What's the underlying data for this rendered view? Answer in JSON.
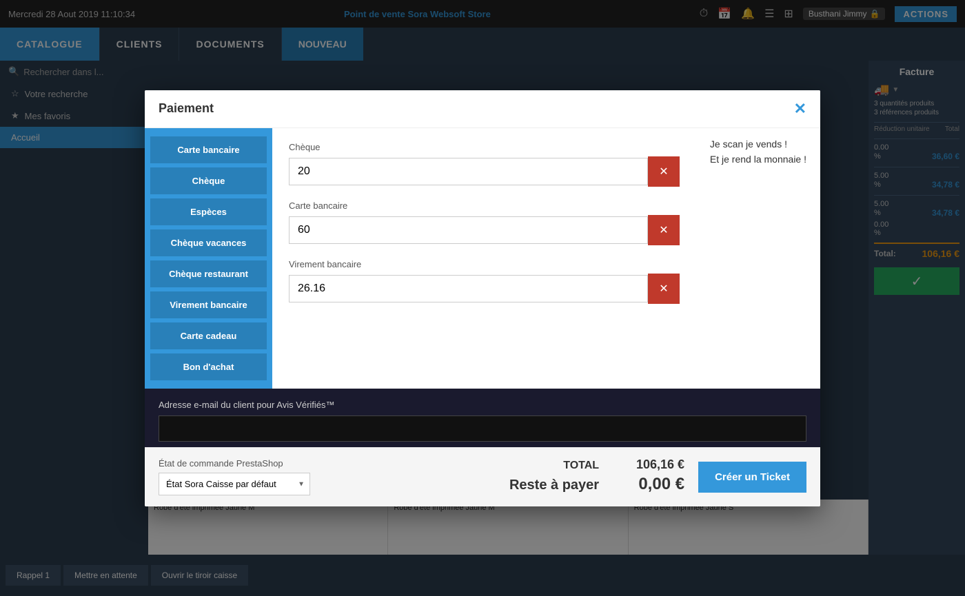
{
  "topbar": {
    "datetime": "Mercredi 28 Aout 2019 11:10:34",
    "pos_label": "Point de vente",
    "store_name": "Sora Websoft Store",
    "user": "Busthani Jimmy",
    "actions_label": "ACTIONS"
  },
  "nav": {
    "items": [
      {
        "label": "CATALOGUE",
        "active": true
      },
      {
        "label": "CLIENTS",
        "active": false
      },
      {
        "label": "DOCUMENTS",
        "active": false
      }
    ],
    "new_label": "NOUVEAU"
  },
  "sidebar": {
    "search_placeholder": "Rechercher dans l...",
    "items": [
      {
        "label": "Votre recherche",
        "icon": "★"
      },
      {
        "label": "Mes favoris",
        "icon": "★"
      }
    ],
    "home_label": "Accueil"
  },
  "right_panel": {
    "title": "Facture",
    "qty_label": "3 quantités produits",
    "ref_label": "3 références produits",
    "reduction_label": "Réduction unitaire",
    "total_label": "Total",
    "rows": [
      {
        "reduction": "0.00",
        "pct": "%",
        "total": "36,60 €"
      },
      {
        "reduction": "5.00",
        "pct": "%",
        "total": "34,78 €"
      },
      {
        "reduction": "5.00",
        "pct": "%",
        "total": "34,78 €"
      }
    ],
    "grand_total_label": "Total:",
    "grand_total_value": "106,16 €"
  },
  "modal": {
    "title": "Paiement",
    "close_label": "✕",
    "methods": [
      {
        "label": "Carte bancaire"
      },
      {
        "label": "Chèque"
      },
      {
        "label": "Espèces"
      },
      {
        "label": "Chèque vacances"
      },
      {
        "label": "Chèque restaurant"
      },
      {
        "label": "Virement bancaire"
      },
      {
        "label": "Carte cadeau"
      },
      {
        "label": "Bon d'achat"
      }
    ],
    "entries": [
      {
        "label": "Chèque",
        "value": "20",
        "remove": "✕"
      },
      {
        "label": "Carte bancaire",
        "value": "60",
        "remove": "✕"
      },
      {
        "label": "Virement bancaire",
        "value": "26.16",
        "remove": "✕"
      }
    ],
    "message_line1": "Je scan je vends !",
    "message_line2": "Et je rend la monnaie !",
    "email_label": "Adresse e-mail du client pour Avis Vérifiés™",
    "email_placeholder": "",
    "footer": {
      "state_label": "État de commande PrestaShop",
      "state_value": "État Sora Caisse par défaut",
      "total_label": "TOTAL",
      "total_value": "106,16 €",
      "reste_label": "Reste à payer",
      "reste_value": "0,00 €",
      "create_ticket_label": "Créer un Ticket"
    }
  },
  "products": [
    {
      "name": "Robe d'été imprimée Jaune M"
    },
    {
      "name": "Robe d'été imprimée Jaune M"
    },
    {
      "name": "Robe d'été imprimée Jaune S"
    }
  ],
  "bottom_btns": [
    {
      "label": "Rappel 1"
    },
    {
      "label": "Mettre en attente"
    },
    {
      "label": "Ouvrir le tiroir caisse"
    }
  ]
}
